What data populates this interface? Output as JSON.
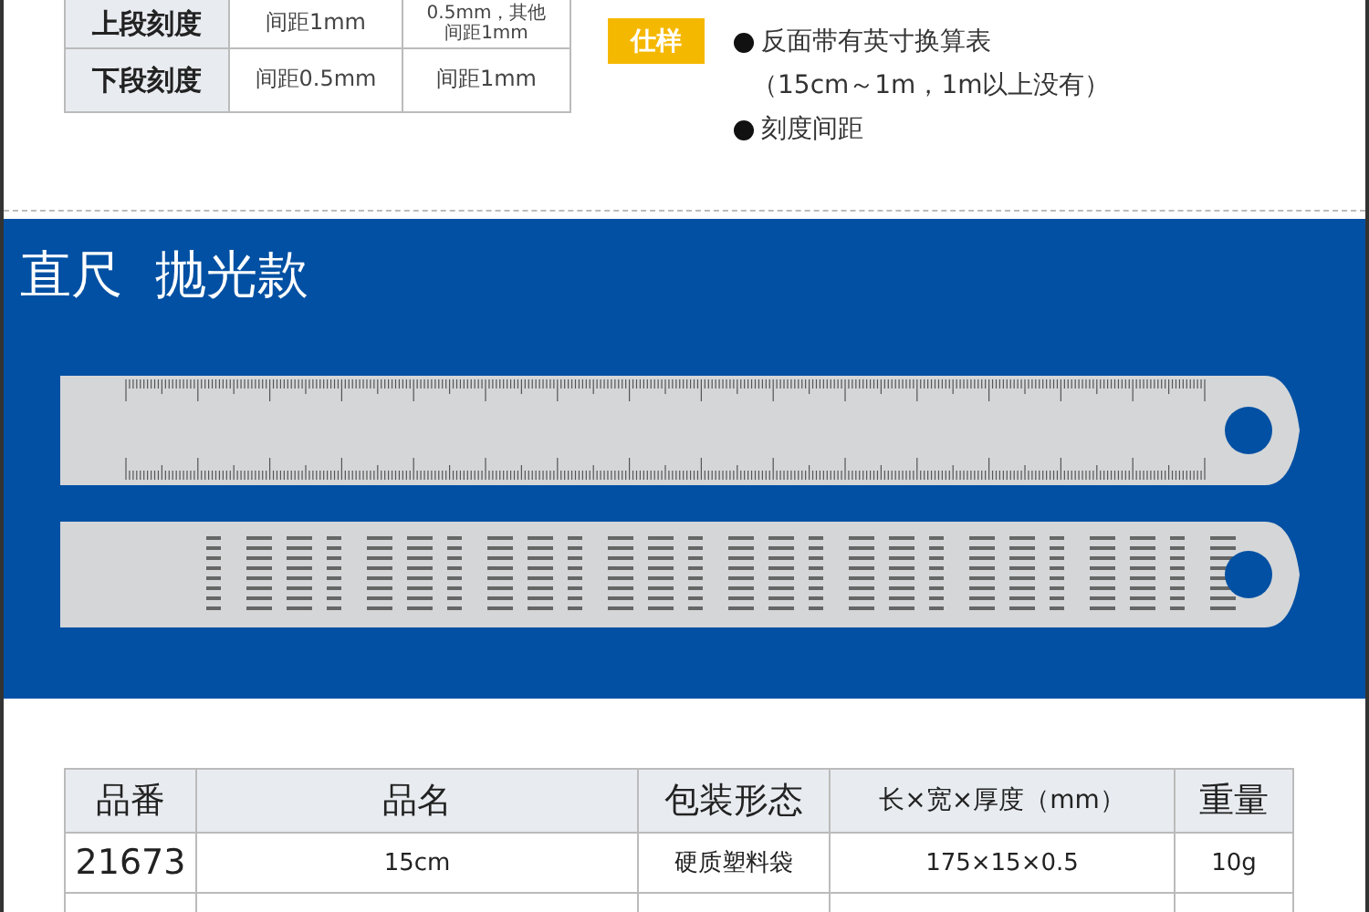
{
  "scale_table": {
    "rows": [
      {
        "label": "上段刻度",
        "cells": [
          [
            "间距1mm"
          ],
          [
            "0.5mm，其他",
            "间距1mm"
          ]
        ]
      },
      {
        "label": "下段刻度",
        "cells": [
          [
            "间距0.5mm"
          ],
          [
            "间距1mm"
          ]
        ]
      }
    ]
  },
  "spec": {
    "badge": "仕样",
    "lines": [
      {
        "kind": "bullet",
        "text": "反面带有英寸换算表"
      },
      {
        "kind": "note",
        "text": "（15cm～1m，1m以上没有）"
      },
      {
        "kind": "bullet",
        "text": "刻度间距"
      }
    ]
  },
  "banner": {
    "title": "直尺  抛光款"
  },
  "product_table": {
    "columns": [
      "品番",
      "品名",
      "包装形态",
      "长×宽×厚度（mm）",
      "重量"
    ],
    "rows": [
      [
        "21673",
        "15cm",
        "硬质塑料袋",
        "175×15×0.5",
        "10g"
      ]
    ]
  }
}
